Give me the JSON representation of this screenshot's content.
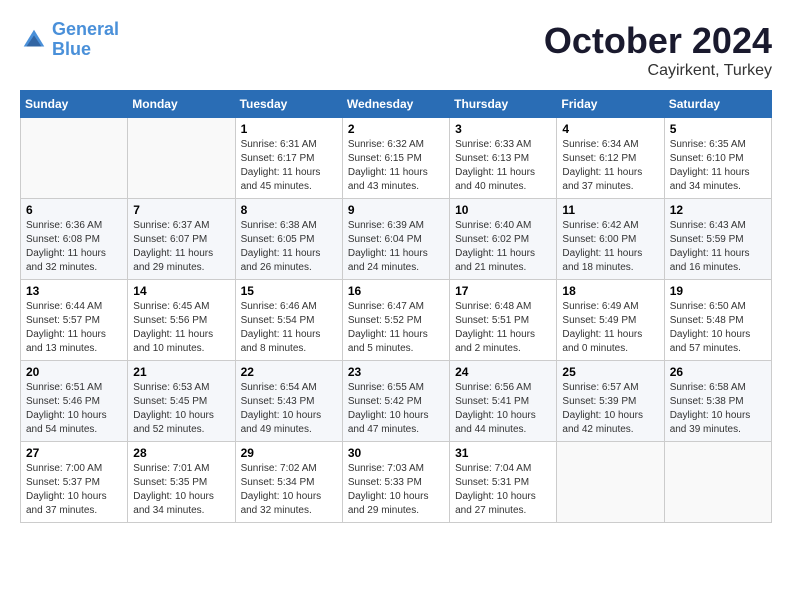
{
  "header": {
    "logo_line1": "General",
    "logo_line2": "Blue",
    "month": "October 2024",
    "location": "Cayirkent, Turkey"
  },
  "weekdays": [
    "Sunday",
    "Monday",
    "Tuesday",
    "Wednesday",
    "Thursday",
    "Friday",
    "Saturday"
  ],
  "weeks": [
    [
      {
        "day": "",
        "content": ""
      },
      {
        "day": "",
        "content": ""
      },
      {
        "day": "1",
        "content": "Sunrise: 6:31 AM\nSunset: 6:17 PM\nDaylight: 11 hours and 45 minutes."
      },
      {
        "day": "2",
        "content": "Sunrise: 6:32 AM\nSunset: 6:15 PM\nDaylight: 11 hours and 43 minutes."
      },
      {
        "day": "3",
        "content": "Sunrise: 6:33 AM\nSunset: 6:13 PM\nDaylight: 11 hours and 40 minutes."
      },
      {
        "day": "4",
        "content": "Sunrise: 6:34 AM\nSunset: 6:12 PM\nDaylight: 11 hours and 37 minutes."
      },
      {
        "day": "5",
        "content": "Sunrise: 6:35 AM\nSunset: 6:10 PM\nDaylight: 11 hours and 34 minutes."
      }
    ],
    [
      {
        "day": "6",
        "content": "Sunrise: 6:36 AM\nSunset: 6:08 PM\nDaylight: 11 hours and 32 minutes."
      },
      {
        "day": "7",
        "content": "Sunrise: 6:37 AM\nSunset: 6:07 PM\nDaylight: 11 hours and 29 minutes."
      },
      {
        "day": "8",
        "content": "Sunrise: 6:38 AM\nSunset: 6:05 PM\nDaylight: 11 hours and 26 minutes."
      },
      {
        "day": "9",
        "content": "Sunrise: 6:39 AM\nSunset: 6:04 PM\nDaylight: 11 hours and 24 minutes."
      },
      {
        "day": "10",
        "content": "Sunrise: 6:40 AM\nSunset: 6:02 PM\nDaylight: 11 hours and 21 minutes."
      },
      {
        "day": "11",
        "content": "Sunrise: 6:42 AM\nSunset: 6:00 PM\nDaylight: 11 hours and 18 minutes."
      },
      {
        "day": "12",
        "content": "Sunrise: 6:43 AM\nSunset: 5:59 PM\nDaylight: 11 hours and 16 minutes."
      }
    ],
    [
      {
        "day": "13",
        "content": "Sunrise: 6:44 AM\nSunset: 5:57 PM\nDaylight: 11 hours and 13 minutes."
      },
      {
        "day": "14",
        "content": "Sunrise: 6:45 AM\nSunset: 5:56 PM\nDaylight: 11 hours and 10 minutes."
      },
      {
        "day": "15",
        "content": "Sunrise: 6:46 AM\nSunset: 5:54 PM\nDaylight: 11 hours and 8 minutes."
      },
      {
        "day": "16",
        "content": "Sunrise: 6:47 AM\nSunset: 5:52 PM\nDaylight: 11 hours and 5 minutes."
      },
      {
        "day": "17",
        "content": "Sunrise: 6:48 AM\nSunset: 5:51 PM\nDaylight: 11 hours and 2 minutes."
      },
      {
        "day": "18",
        "content": "Sunrise: 6:49 AM\nSunset: 5:49 PM\nDaylight: 11 hours and 0 minutes."
      },
      {
        "day": "19",
        "content": "Sunrise: 6:50 AM\nSunset: 5:48 PM\nDaylight: 10 hours and 57 minutes."
      }
    ],
    [
      {
        "day": "20",
        "content": "Sunrise: 6:51 AM\nSunset: 5:46 PM\nDaylight: 10 hours and 54 minutes."
      },
      {
        "day": "21",
        "content": "Sunrise: 6:53 AM\nSunset: 5:45 PM\nDaylight: 10 hours and 52 minutes."
      },
      {
        "day": "22",
        "content": "Sunrise: 6:54 AM\nSunset: 5:43 PM\nDaylight: 10 hours and 49 minutes."
      },
      {
        "day": "23",
        "content": "Sunrise: 6:55 AM\nSunset: 5:42 PM\nDaylight: 10 hours and 47 minutes."
      },
      {
        "day": "24",
        "content": "Sunrise: 6:56 AM\nSunset: 5:41 PM\nDaylight: 10 hours and 44 minutes."
      },
      {
        "day": "25",
        "content": "Sunrise: 6:57 AM\nSunset: 5:39 PM\nDaylight: 10 hours and 42 minutes."
      },
      {
        "day": "26",
        "content": "Sunrise: 6:58 AM\nSunset: 5:38 PM\nDaylight: 10 hours and 39 minutes."
      }
    ],
    [
      {
        "day": "27",
        "content": "Sunrise: 7:00 AM\nSunset: 5:37 PM\nDaylight: 10 hours and 37 minutes."
      },
      {
        "day": "28",
        "content": "Sunrise: 7:01 AM\nSunset: 5:35 PM\nDaylight: 10 hours and 34 minutes."
      },
      {
        "day": "29",
        "content": "Sunrise: 7:02 AM\nSunset: 5:34 PM\nDaylight: 10 hours and 32 minutes."
      },
      {
        "day": "30",
        "content": "Sunrise: 7:03 AM\nSunset: 5:33 PM\nDaylight: 10 hours and 29 minutes."
      },
      {
        "day": "31",
        "content": "Sunrise: 7:04 AM\nSunset: 5:31 PM\nDaylight: 10 hours and 27 minutes."
      },
      {
        "day": "",
        "content": ""
      },
      {
        "day": "",
        "content": ""
      }
    ]
  ]
}
